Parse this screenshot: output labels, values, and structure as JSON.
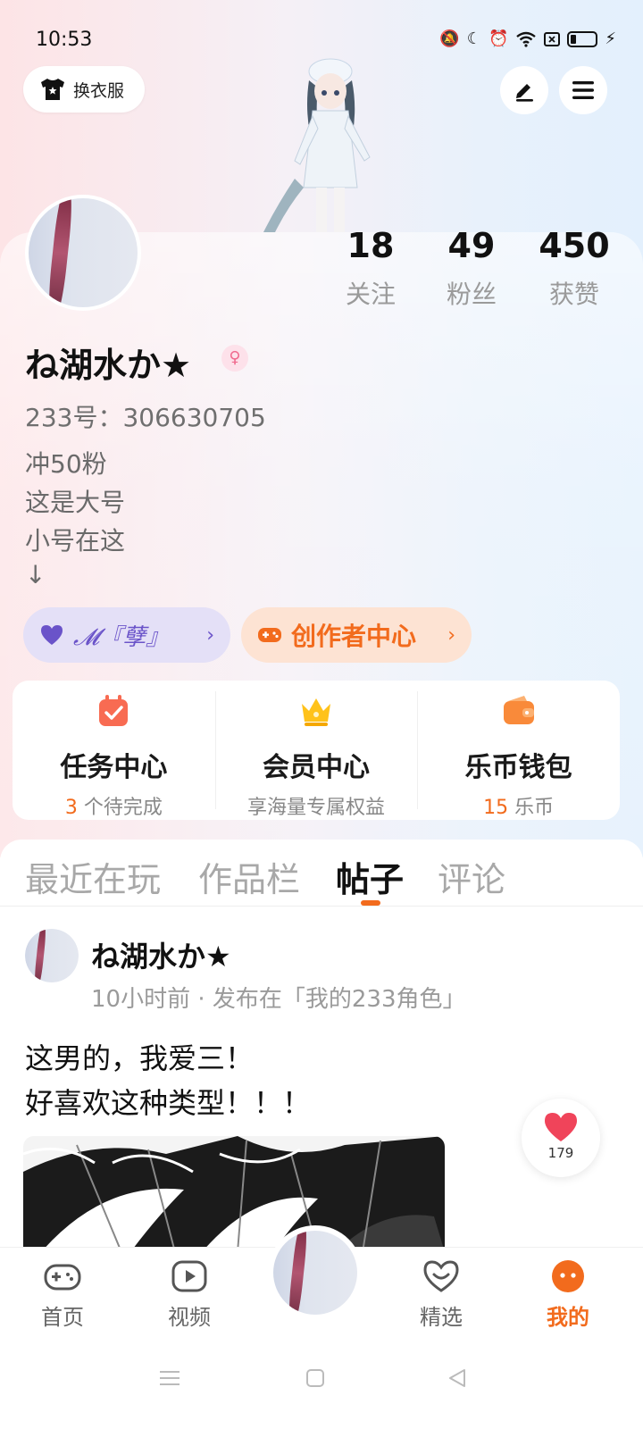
{
  "status_bar": {
    "time": "10:53"
  },
  "header": {
    "outfit_label": "换衣服"
  },
  "stats": [
    {
      "num": "18",
      "label": "关注"
    },
    {
      "num": "49",
      "label": "粉丝"
    },
    {
      "num": "450",
      "label": "获赞"
    }
  ],
  "profile": {
    "username": "ね湖水か★",
    "gender_symbol": "♀",
    "account_id": "233号：306630705",
    "bio": [
      "冲50粉",
      "这是大号",
      "小号在这",
      "↓"
    ]
  },
  "pills": {
    "guild": "𝓜『孽』",
    "creator": "创作者中心"
  },
  "cards": [
    {
      "title": "任务中心",
      "sub_highlight": "3",
      "sub_text": " 个待完成"
    },
    {
      "title": "会员中心",
      "sub_highlight": "",
      "sub_text": "享海量专属权益"
    },
    {
      "title": "乐币钱包",
      "sub_highlight": "15",
      "sub_text": " 乐币"
    }
  ],
  "tabs": [
    "最近在玩",
    "作品栏",
    "帖子",
    "评论"
  ],
  "active_tab": "帖子",
  "post": {
    "author": "ね湖水か★",
    "meta": "10小时前 · 发布在「我的233角色」",
    "lines": [
      "这男的，我爱三！",
      "好喜欢这种类型！！！"
    ],
    "likes": "179"
  },
  "bottom_nav": [
    {
      "label": "首页",
      "icon": "gamepad-icon"
    },
    {
      "label": "视频",
      "icon": "video-play-icon"
    },
    {
      "label": "精选",
      "icon": "heart-chat-icon"
    },
    {
      "label": "我的",
      "icon": "me-face-icon"
    }
  ],
  "colors": {
    "accent": "#f26b1d",
    "guild": "#6a53c9",
    "heart": "#f0445a"
  }
}
